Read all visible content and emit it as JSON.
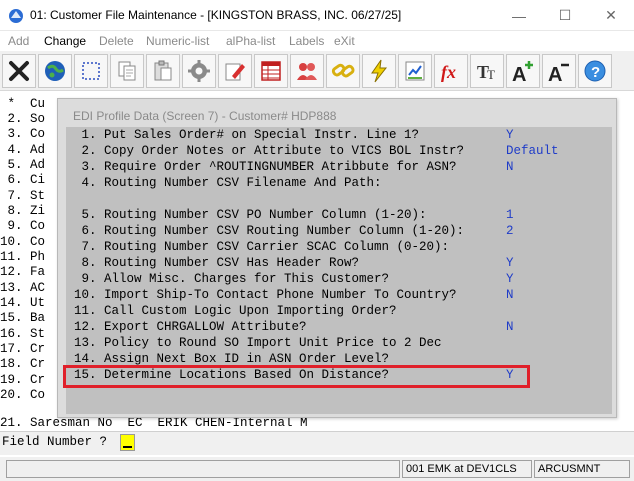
{
  "window": {
    "title": "01: Customer File Maintenance - [KINGSTON BRASS, INC. 06/27/25]",
    "minimize": "—",
    "maximize": "☐",
    "close": "✕"
  },
  "menu": [
    "Add",
    "Change",
    "Delete",
    "Numeric-list",
    "alPha-list",
    "Labels",
    "eXit"
  ],
  "toolbar": [
    "close-x-icon",
    "globe-icon",
    "select-icon",
    "copy-icon",
    "paste-icon",
    "settings-icon",
    "edit-icon",
    "table-icon",
    "users-icon",
    "link-icon",
    "lightning-icon",
    "report-icon",
    "function-icon",
    "font-icon",
    "font-increase-icon",
    "font-decrease-icon",
    "help-icon"
  ],
  "background_lines": [
    " *  Cu",
    " 2. So",
    " 3. Co",
    " 4. Ad",
    " 5. Ad",
    " 6. Ci",
    " 7. St",
    " 8. Zi",
    " 9. Co",
    "10. Co",
    "11. Ph",
    "12. Fa",
    "13. AC",
    "14. Ut",
    "15. Ba",
    "16. St",
    "17. Cr",
    "18. Cr",
    "19. Cr",
    "20. Co",
    "21. Saresman No  EC  ERIK CHEN-Internal M"
  ],
  "field_prompt": "Field Number ?",
  "status": {
    "user": "001 EMK at DEV1CLS",
    "program": "ARCUSMNT"
  },
  "dialog": {
    "title": "EDI Profile Data (Screen 7) - Customer# HDP888",
    "options": [
      {
        "label": " 1. Put Sales Order# on Special Instr. Line 1?",
        "value": "Y"
      },
      {
        "label": " 2. Copy Order Notes or Attribute to VICS BOL Instr?",
        "value": "Default"
      },
      {
        "label": " 3. Require Order ^ROUTINGNUMBER Atribbute for ASN?",
        "value": "N"
      },
      {
        "label": " 4. Routing Number CSV Filename And Path:",
        "value": ""
      },
      {
        "label": "",
        "value": ""
      },
      {
        "label": " 5. Routing Number CSV PO Number Column (1-20):",
        "value": "1"
      },
      {
        "label": " 6. Routing Number CSV Routing Number Column (1-20):",
        "value": "2"
      },
      {
        "label": " 7. Routing Number CSV Carrier SCAC Column (0-20):",
        "value": ""
      },
      {
        "label": " 8. Routing Number CSV Has Header Row?",
        "value": "Y"
      },
      {
        "label": " 9. Allow Misc. Charges for This Customer?",
        "value": "Y"
      },
      {
        "label": "10. Import Ship-To Contact Phone Number To Country?",
        "value": "N"
      },
      {
        "label": "11. Call Custom Logic Upon Importing Order?",
        "value": ""
      },
      {
        "label": "12. Export CHRGALLOW Attribute?",
        "value": "N"
      },
      {
        "label": "13. Policy to Round SO Import Unit Price to 2 Dec",
        "value": ""
      },
      {
        "label": "14. Assign Next Box ID in ASN Order Level?",
        "value": ""
      },
      {
        "label": "15. Determine Locations Based On Distance?",
        "value": "Y"
      }
    ]
  },
  "colors": {
    "value_blue": "#1f3cc8",
    "highlight_red": "#e0202a",
    "cursor_yellow": "#ffff00"
  }
}
